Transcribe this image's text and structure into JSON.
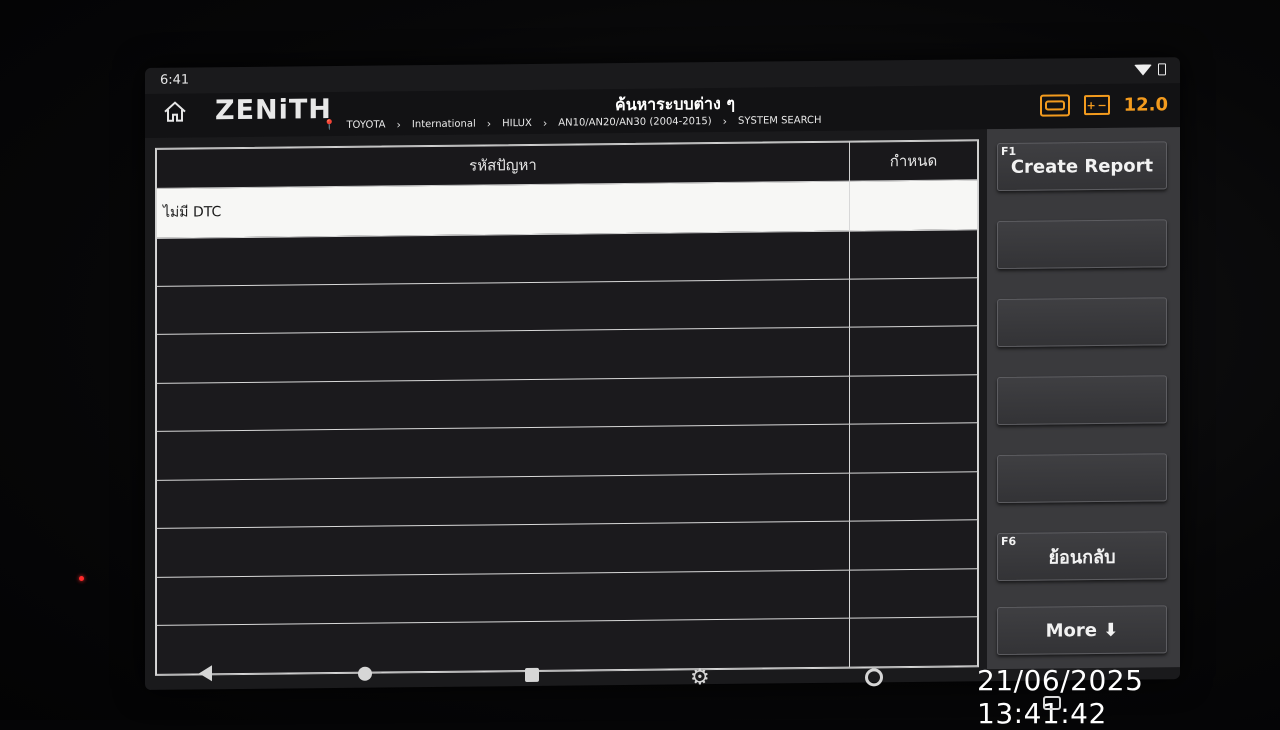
{
  "statusbar": {
    "time": "6:41"
  },
  "header": {
    "logo": "ZENiTH",
    "title": "ค้นหาระบบต่าง ๆ",
    "voltage": "12.0",
    "breadcrumb": [
      "TOYOTA",
      "International",
      "HILUX",
      "AN10/AN20/AN30 (2004-2015)",
      "SYSTEM SEARCH"
    ]
  },
  "table": {
    "columns": [
      "รหัสปัญหา",
      "กำหนด"
    ],
    "rows": [
      {
        "code": "ไม่มี DTC",
        "def": ""
      }
    ]
  },
  "side_panel": {
    "buttons": [
      {
        "key": "F1",
        "label": "Create Report"
      },
      {
        "key": "",
        "label": ""
      },
      {
        "key": "",
        "label": ""
      },
      {
        "key": "",
        "label": ""
      },
      {
        "key": "",
        "label": ""
      },
      {
        "key": "F6",
        "label": "ย้อนกลับ"
      },
      {
        "key": "",
        "label": "More ⬇"
      }
    ]
  },
  "overlay": {
    "timestamp": "21/06/2025 13:41:42"
  },
  "colors": {
    "accent": "#f39b1e",
    "panel": "#3a3a3d",
    "selected_row": "#f7f7f5"
  }
}
